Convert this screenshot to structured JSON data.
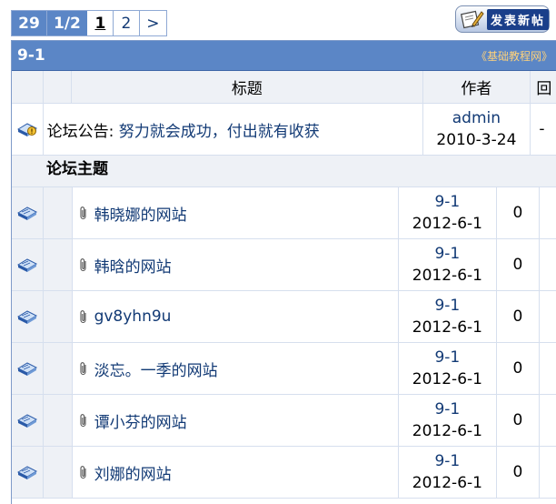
{
  "pager": {
    "total": "29",
    "fraction": "1/2",
    "current": "1",
    "next_page": "2",
    "next_arrow": ">"
  },
  "post_button": {
    "label": "发表新帖",
    "icon": "pencil-paper-icon"
  },
  "forum": {
    "name": "9-1",
    "crumb": "《基础教程网》",
    "header_color": "#5b86c6"
  },
  "columns": {
    "title": "标题",
    "author": "作者",
    "reply": "回"
  },
  "notice": {
    "prefix": "论坛公告:",
    "title": "努力就会成功，付出就有收获",
    "author": "admin",
    "date": "2010-3-24",
    "reply": "-",
    "icon": "announcement-icon"
  },
  "section": {
    "title": "论坛主题"
  },
  "topics": [
    {
      "title": "韩晓娜的网站",
      "author": "9-1",
      "date": "2012-6-1",
      "replies": "0"
    },
    {
      "title": "韩晗的网站",
      "author": "9-1",
      "date": "2012-6-1",
      "replies": "0"
    },
    {
      "title": "gv8yhn9u",
      "author": "9-1",
      "date": "2012-6-1",
      "replies": "0"
    },
    {
      "title": "淡忘。一季的网站",
      "author": "9-1",
      "date": "2012-6-1",
      "replies": "0"
    },
    {
      "title": "谭小芬的网站",
      "author": "9-1",
      "date": "2012-6-1",
      "replies": "0"
    },
    {
      "title": "刘娜的网站",
      "author": "9-1",
      "date": "2012-6-1",
      "replies": "0"
    }
  ],
  "colors": {
    "link": "#123a75",
    "row_alt": "#eef1f6",
    "border": "#d6dfee"
  }
}
